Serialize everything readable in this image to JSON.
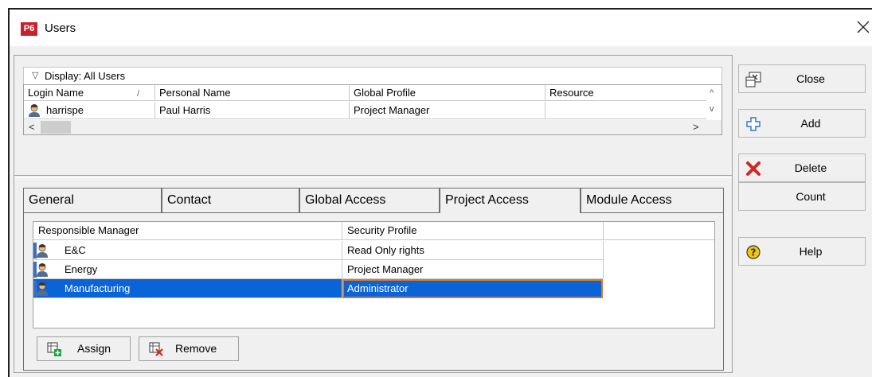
{
  "window": {
    "title": "Users",
    "app_icon_text": "P6"
  },
  "users_grid": {
    "display_label": "Display: All Users",
    "columns": [
      "Login Name",
      "Personal Name",
      "Global Profile",
      "Resource"
    ],
    "sort_indicator": "/",
    "rows": [
      {
        "login": "harrispe",
        "personal_name": "Paul Harris",
        "global_profile": "Project Manager",
        "resource": ""
      }
    ]
  },
  "tabs": [
    {
      "label": "General",
      "active": false
    },
    {
      "label": "Contact",
      "active": false
    },
    {
      "label": "Global Access",
      "active": false
    },
    {
      "label": "Project Access",
      "active": true
    },
    {
      "label": "Module Access",
      "active": false
    }
  ],
  "project_access": {
    "columns": [
      "Responsible Manager",
      "Security Profile"
    ],
    "rows": [
      {
        "manager": "E&C",
        "profile": "Read Only rights",
        "selected": false
      },
      {
        "manager": "Energy",
        "profile": "Project Manager",
        "selected": false
      },
      {
        "manager": "Manufacturing",
        "profile": "Administrator",
        "selected": true
      }
    ],
    "assign_label": "Assign",
    "remove_label": "Remove"
  },
  "side_buttons": [
    {
      "label": "Close",
      "icon": "close-window-icon"
    },
    {
      "label": "Add",
      "icon": "plus-icon"
    },
    {
      "label": "Delete",
      "icon": "red-x-icon"
    },
    {
      "label": "Count",
      "icon": ""
    },
    {
      "label": "Help",
      "icon": "help-icon"
    }
  ],
  "colors": {
    "selection": "#0a64d8",
    "focus_border": "#e07a1f",
    "app_icon": "#c8202d",
    "delete_icon": "#d0281e",
    "help_icon": "#f2c40f"
  }
}
